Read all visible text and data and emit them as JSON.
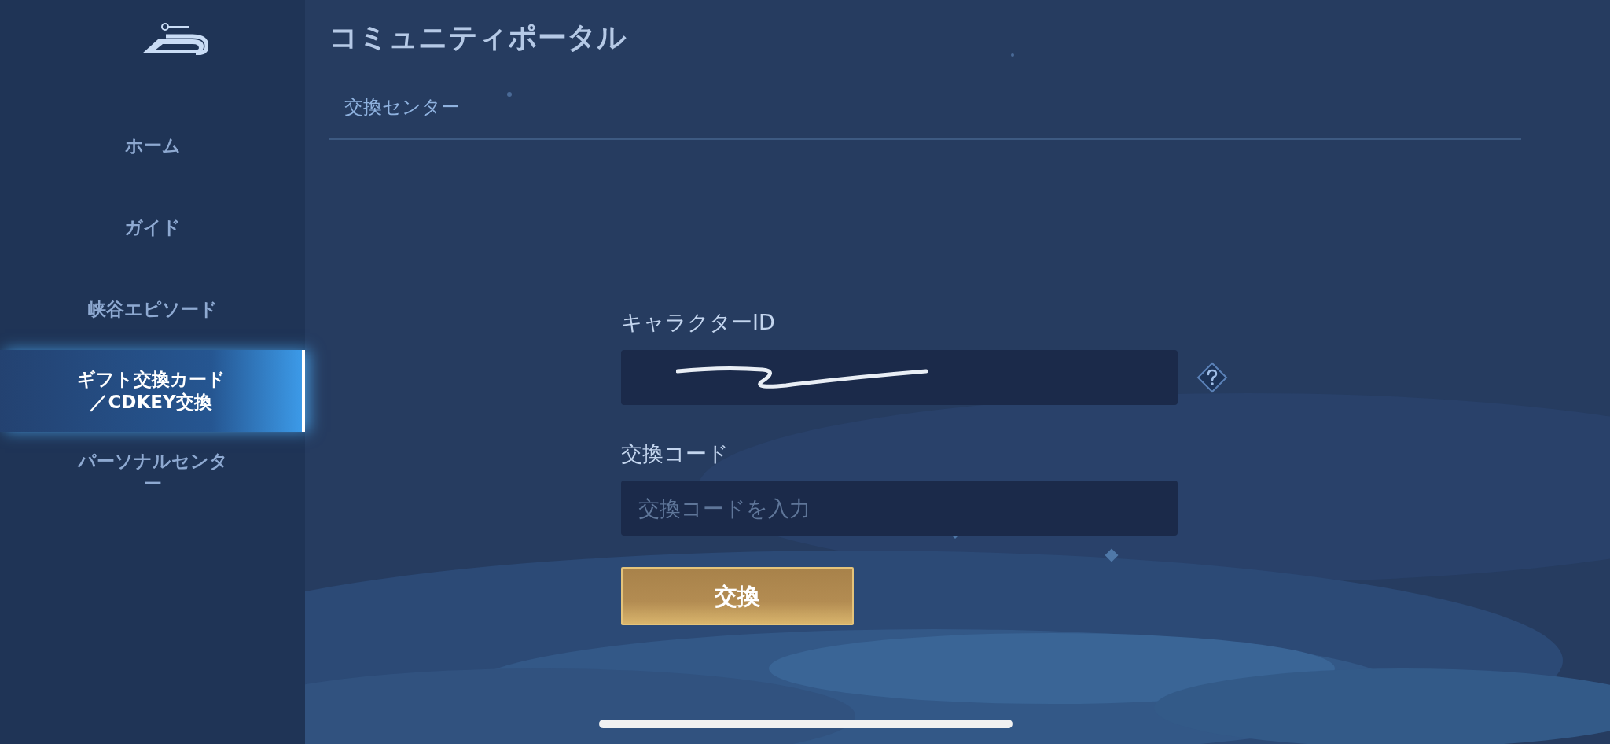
{
  "sidebar": {
    "items": [
      {
        "label": "ホーム",
        "selected": false
      },
      {
        "label": "ガイド",
        "selected": false
      },
      {
        "label": "峡谷エピソード",
        "selected": false
      },
      {
        "label": "ギフト交換カード／CDKEY交換",
        "selected": true
      },
      {
        "label": "パーソナルセンター",
        "selected": false
      }
    ]
  },
  "header": {
    "title": "コミュニティポータル",
    "section": "交換センター"
  },
  "form": {
    "fields": [
      {
        "label": "キャラクターID",
        "redacted": true,
        "help": true
      },
      {
        "label": "交換コード",
        "placeholder": "交換コードを入力",
        "redacted": false,
        "help": false
      }
    ],
    "submit": "交換"
  }
}
